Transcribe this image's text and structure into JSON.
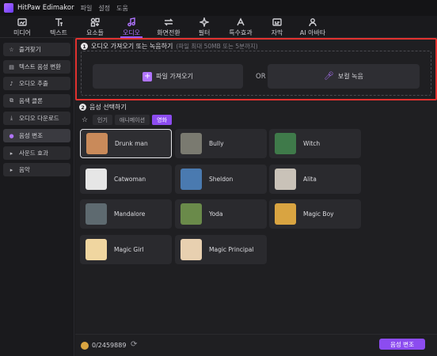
{
  "titlebar": {
    "app_name": "HitPaw Edimakor",
    "menus": [
      "파일",
      "설정",
      "도움"
    ]
  },
  "toolbar": {
    "tools": [
      {
        "label": "미디어",
        "icon": "media-icon"
      },
      {
        "label": "텍스트",
        "icon": "text-icon"
      },
      {
        "label": "요소들",
        "icon": "elements-icon"
      },
      {
        "label": "오디오",
        "icon": "music-note-icon",
        "active": true
      },
      {
        "label": "화면전환",
        "icon": "transition-icon"
      },
      {
        "label": "필터",
        "icon": "filter-sparkle-icon"
      },
      {
        "label": "특수효과",
        "icon": "effects-icon"
      },
      {
        "label": "자막",
        "icon": "subtitle-icon"
      },
      {
        "label": "AI 아바타",
        "icon": "avatar-person-icon"
      }
    ]
  },
  "sidebar": {
    "items": [
      {
        "label": "즐겨찾기",
        "icon": "star-icon"
      },
      {
        "label": "텍스트 음성 변환",
        "icon": "text-to-speech-icon"
      },
      {
        "label": "오디오 추출",
        "icon": "microphone-icon"
      },
      {
        "label": "음색 클론",
        "icon": "voice-clone-icon"
      },
      {
        "label": "오디오 다운로드",
        "icon": "download-icon"
      },
      {
        "label": "음성 변조",
        "icon": "voice-changer-icon",
        "active": true
      },
      {
        "label": "사운드 효과",
        "icon": "chevron-right-icon"
      },
      {
        "label": "음악",
        "icon": "chevron-right-icon"
      }
    ]
  },
  "upload": {
    "step": "1",
    "title": "오디오 가져오기 또는 녹음하기",
    "hint": "(파일 최대 50MB 또는 5분까지)",
    "import_label": "파일 가져오기",
    "or_label": "OR",
    "record_label": "보컬 녹음"
  },
  "voices": {
    "step": "2",
    "title": "음성 선택하기",
    "filters": [
      "인기",
      "애니메이션",
      "영화"
    ],
    "active_filter": "영화",
    "items": [
      {
        "name": "Drunk man",
        "selected": true,
        "avatar_color": "#c98a5a"
      },
      {
        "name": "Bully",
        "avatar_color": "#7a7a70"
      },
      {
        "name": "Witch",
        "avatar_color": "#3f7a4a"
      },
      {
        "name": "Catwoman",
        "avatar_color": "#e6e6e6"
      },
      {
        "name": "Sheldon",
        "avatar_color": "#4a7ab0"
      },
      {
        "name": "Alita",
        "avatar_color": "#c9c2b8"
      },
      {
        "name": "Mandalore",
        "avatar_color": "#5e6a70"
      },
      {
        "name": "Yoda",
        "avatar_color": "#6a8a4a"
      },
      {
        "name": "Magic Boy",
        "avatar_color": "#d9a441"
      },
      {
        "name": "Magic Girl",
        "avatar_color": "#f0d6a0"
      },
      {
        "name": "Magic Principal",
        "avatar_color": "#e8d0b0"
      }
    ]
  },
  "footer": {
    "credits": "0/2459889",
    "apply_label": "음성 변조"
  },
  "colors": {
    "accent": "#8c4cf0",
    "highlight_border": "#e2322f"
  }
}
